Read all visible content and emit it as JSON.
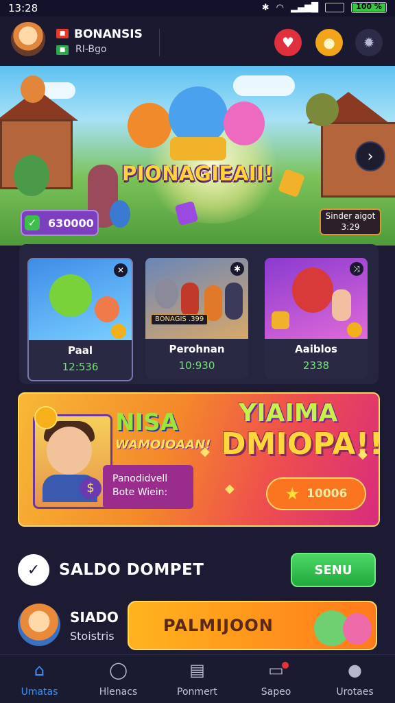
{
  "status_bar": {
    "time": "13:28",
    "battery_text": "100 %",
    "battery_level": 1.0
  },
  "header": {
    "brand_title": "BONANSIS",
    "brand_subtitle": "RI-Bgo"
  },
  "hero": {
    "title": "PIONAGIEAII!",
    "balance_pill": "630000",
    "timer_label": "Sinder aigot",
    "timer_value": "3:29"
  },
  "cards": [
    {
      "label": "Paal",
      "score": "12:536"
    },
    {
      "label": "Perohnan",
      "score": "10:930",
      "tag": "BONAGIS .399"
    },
    {
      "label": "Aaiblos",
      "score": "2338"
    }
  ],
  "promo": {
    "heading1": "NISA",
    "heading2": "WAMOIOAAN!",
    "sub_line1": "Panodidvell",
    "sub_line2": "Bote Wiein:",
    "big_line1": "YIAIMA",
    "big_line2": "DMIOPA!!",
    "button_amount": "10006"
  },
  "wallet": {
    "title": "SALDO DOMPET",
    "send_label": "SENU"
  },
  "balance": {
    "title": "SIADO",
    "subtitle": "Stoistris",
    "play_label": "PALMIJOON"
  },
  "nav": [
    {
      "label": "Umatas",
      "icon": "home-icon",
      "active": true
    },
    {
      "label": "Hlenacs",
      "icon": "search-icon",
      "active": false
    },
    {
      "label": "Ponmert",
      "icon": "clipboard-icon",
      "active": false
    },
    {
      "label": "Sapeo",
      "icon": "chat-icon",
      "active": false
    },
    {
      "label": "Urotaes",
      "icon": "user-icon",
      "active": false
    }
  ],
  "colors": {
    "background": "#1d1b33",
    "accent_blue": "#3c93f5",
    "score_green": "#6ee56e",
    "send_green": "#23a83d",
    "play_orange": "#ff7a1a"
  }
}
